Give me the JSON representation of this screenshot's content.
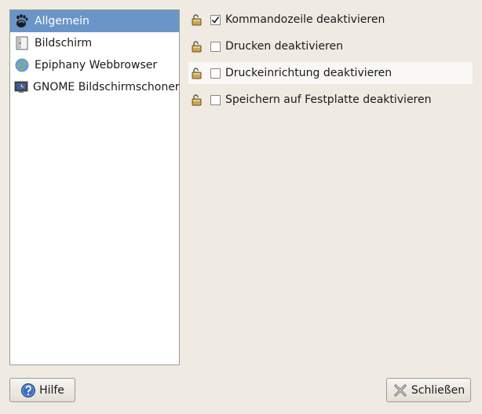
{
  "sidebar": {
    "items": [
      {
        "label": "Allgemein",
        "icon": "gnome-foot-icon",
        "selected": true
      },
      {
        "label": "Bildschirm",
        "icon": "display-icon",
        "selected": false
      },
      {
        "label": "Epiphany Webbrowser",
        "icon": "globe-icon",
        "selected": false
      },
      {
        "label": "GNOME Bildschirmschoner",
        "icon": "screensaver-icon",
        "selected": false
      }
    ]
  },
  "options": [
    {
      "label": "Kommandozeile deaktivieren",
      "checked": true,
      "lock_icon": "unlocked-padlock-icon"
    },
    {
      "label": "Drucken deaktivieren",
      "checked": false,
      "lock_icon": "unlocked-padlock-icon"
    },
    {
      "label": "Druckeinrichtung deaktivieren",
      "checked": false,
      "lock_icon": "unlocked-padlock-icon"
    },
    {
      "label": "Speichern auf Festplatte deaktivieren",
      "checked": false,
      "lock_icon": "unlocked-padlock-icon"
    }
  ],
  "buttons": {
    "help_label": "Hilfe",
    "help_icon": "help-icon",
    "close_label": "Schließen",
    "close_icon": "close-icon"
  },
  "colors": {
    "selection": "#6a95c8",
    "window_bg": "#efebe2"
  }
}
